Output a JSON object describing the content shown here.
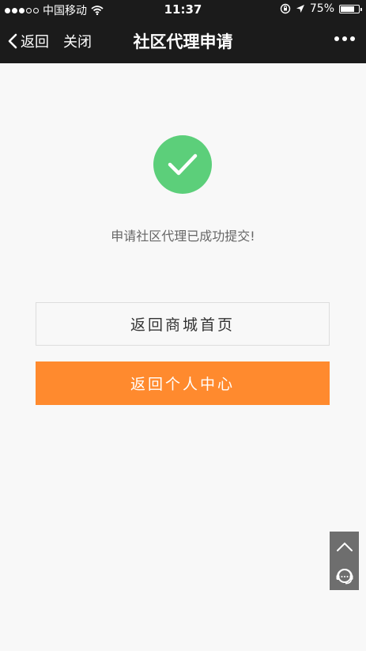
{
  "status_bar": {
    "carrier": "中国移动",
    "time": "11:37",
    "battery": "75%"
  },
  "nav": {
    "back_label": "返回",
    "close_label": "关闭",
    "title": "社区代理申请"
  },
  "main": {
    "message": "申请社区代理已成功提交!",
    "home_button": "返回商城首页",
    "center_button": "返回个人中心"
  },
  "colors": {
    "success_green": "#5ccf7a",
    "accent_orange": "#ff8a2e",
    "bar_bg": "#1b1b1b"
  },
  "icons": {
    "success": "check-icon",
    "scroll_top": "chevron-up-icon",
    "service": "headset-icon"
  }
}
